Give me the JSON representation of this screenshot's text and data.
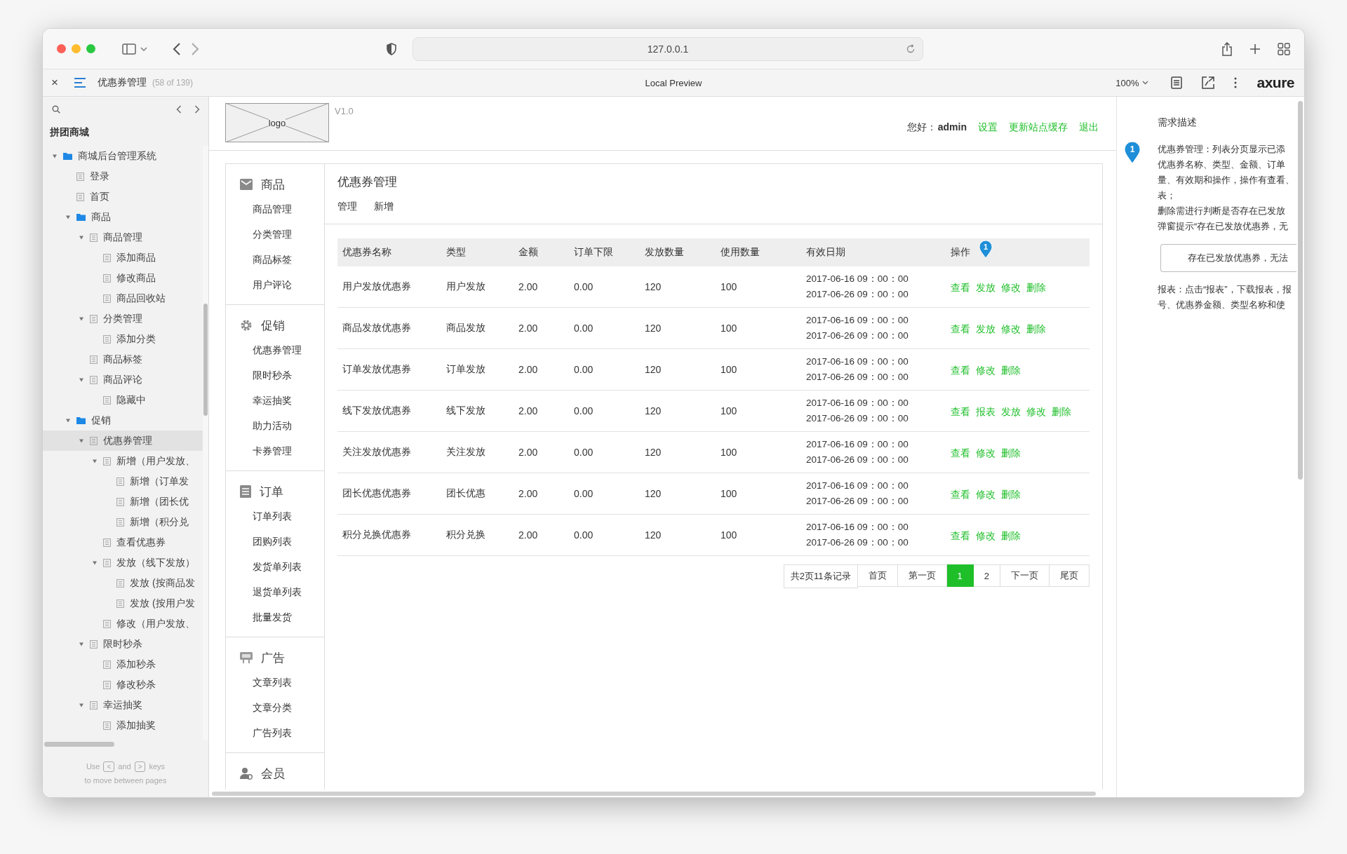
{
  "browser": {
    "url": "127.0.0.1"
  },
  "axure_bar": {
    "close": "×",
    "page_title": "优惠券管理",
    "page_count": "(58 of 139)",
    "center": "Local Preview",
    "zoom": "100%",
    "logo": "axure"
  },
  "sidebar": {
    "project": "拼团商城",
    "tree": [
      {
        "kind": "folder",
        "label": "商城后台管理系统",
        "expanded": true,
        "selected": false,
        "children": [
          {
            "kind": "page",
            "label": "登录",
            "selected": false
          },
          {
            "kind": "page",
            "label": "首页",
            "selected": false
          },
          {
            "kind": "folder",
            "label": "商品",
            "expanded": true,
            "selected": false,
            "children": [
              {
                "kind": "page",
                "label": "商品管理",
                "expanded": true,
                "selected": false,
                "children": [
                  {
                    "kind": "page",
                    "label": "添加商品",
                    "selected": false
                  },
                  {
                    "kind": "page",
                    "label": "修改商品",
                    "selected": false
                  },
                  {
                    "kind": "page",
                    "label": "商品回收站",
                    "selected": false
                  }
                ]
              },
              {
                "kind": "page",
                "label": "分类管理",
                "expanded": true,
                "selected": false,
                "children": [
                  {
                    "kind": "page",
                    "label": "添加分类",
                    "selected": false
                  }
                ]
              },
              {
                "kind": "page",
                "label": "商品标签",
                "selected": false
              },
              {
                "kind": "page",
                "label": "商品评论",
                "expanded": true,
                "selected": false,
                "children": [
                  {
                    "kind": "page",
                    "label": "隐藏中",
                    "selected": false
                  }
                ]
              }
            ]
          },
          {
            "kind": "folder",
            "label": "促销",
            "expanded": true,
            "selected": false,
            "children": [
              {
                "kind": "page",
                "label": "优惠券管理",
                "expanded": true,
                "selected": true,
                "children": [
                  {
                    "kind": "page",
                    "label": "新增（用户发放、",
                    "expanded": true,
                    "selected": false,
                    "children": [
                      {
                        "kind": "page",
                        "label": "新增（订单发",
                        "selected": false
                      },
                      {
                        "kind": "page",
                        "label": "新增（团长优",
                        "selected": false
                      },
                      {
                        "kind": "page",
                        "label": "新增（积分兑",
                        "selected": false
                      }
                    ]
                  },
                  {
                    "kind": "page",
                    "label": "查看优惠券",
                    "selected": false
                  },
                  {
                    "kind": "page",
                    "label": "发放（线下发放）",
                    "expanded": true,
                    "selected": false,
                    "children": [
                      {
                        "kind": "page",
                        "label": "发放 (按商品发",
                        "selected": false
                      },
                      {
                        "kind": "page",
                        "label": "发放 (按用户发",
                        "selected": false
                      }
                    ]
                  },
                  {
                    "kind": "page",
                    "label": "修改（用户发放、",
                    "selected": false
                  }
                ]
              },
              {
                "kind": "page",
                "label": "限时秒杀",
                "expanded": true,
                "selected": false,
                "children": [
                  {
                    "kind": "page",
                    "label": "添加秒杀",
                    "selected": false
                  },
                  {
                    "kind": "page",
                    "label": "修改秒杀",
                    "selected": false
                  }
                ]
              },
              {
                "kind": "page",
                "label": "幸运抽奖",
                "expanded": true,
                "selected": false,
                "children": [
                  {
                    "kind": "page",
                    "label": "添加抽奖",
                    "selected": false
                  }
                ]
              }
            ]
          }
        ]
      }
    ],
    "footer": {
      "use": "Use",
      "key_prev": "<",
      "and": "and",
      "key_next": ">",
      "keys": "keys",
      "hint": "to move between pages"
    }
  },
  "header": {
    "logo": "logo",
    "version": "V1.0",
    "greeting": "您好：",
    "user": "admin",
    "links": [
      "设置",
      "更新站点缓存",
      "退出"
    ]
  },
  "nav": [
    {
      "title": "商品",
      "items": [
        "商品管理",
        "分类管理",
        "商品标签",
        "用户评论"
      ]
    },
    {
      "title": "促销",
      "items": [
        "优惠券管理",
        "限时秒杀",
        "幸运抽奖",
        "助力活动",
        "卡券管理"
      ]
    },
    {
      "title": "订单",
      "items": [
        "订单列表",
        "团购列表",
        "发货单列表",
        "退货单列表",
        "批量发货"
      ]
    },
    {
      "title": "广告",
      "items": [
        "文章列表",
        "文章分类",
        "广告列表"
      ]
    },
    {
      "title": "会员"
    }
  ],
  "content": {
    "title": "优惠券管理",
    "tabs": [
      "管理",
      "新增"
    ],
    "table": {
      "columns": [
        "优惠券名称",
        "类型",
        "金额",
        "订单下限",
        "发放数量",
        "使用数量",
        "有效日期",
        "操作"
      ],
      "marker": "1",
      "rows": [
        {
          "name": "用户发放优惠券",
          "type": "用户发放",
          "amount": "2.00",
          "min_order": "0.00",
          "issued": "120",
          "used": "100",
          "date_start": "2017-06-16 09：00：00",
          "date_end": "2017-06-26 09：00：00",
          "actions": [
            "查看",
            "发放",
            "修改",
            "删除"
          ]
        },
        {
          "name": "商品发放优惠券",
          "type": "商品发放",
          "amount": "2.00",
          "min_order": "0.00",
          "issued": "120",
          "used": "100",
          "date_start": "2017-06-16 09：00：00",
          "date_end": "2017-06-26 09：00：00",
          "actions": [
            "查看",
            "发放",
            "修改",
            "删除"
          ]
        },
        {
          "name": "订单发放优惠券",
          "type": "订单发放",
          "amount": "2.00",
          "min_order": "0.00",
          "issued": "120",
          "used": "100",
          "date_start": "2017-06-16 09：00：00",
          "date_end": "2017-06-26 09：00：00",
          "actions": [
            "查看",
            "修改",
            "删除"
          ]
        },
        {
          "name": "线下发放优惠券",
          "type": "线下发放",
          "amount": "2.00",
          "min_order": "0.00",
          "issued": "120",
          "used": "100",
          "date_start": "2017-06-16 09：00：00",
          "date_end": "2017-06-26 09：00：00",
          "actions": [
            "查看",
            "报表",
            "发放",
            "修改",
            "删除"
          ]
        },
        {
          "name": "关注发放优惠券",
          "type": "关注发放",
          "amount": "2.00",
          "min_order": "0.00",
          "issued": "120",
          "used": "100",
          "date_start": "2017-06-16 09：00：00",
          "date_end": "2017-06-26 09：00：00",
          "actions": [
            "查看",
            "修改",
            "删除"
          ]
        },
        {
          "name": "团长优惠优惠券",
          "type": "团长优惠",
          "amount": "2.00",
          "min_order": "0.00",
          "issued": "120",
          "used": "100",
          "date_start": "2017-06-16 09：00：00",
          "date_end": "2017-06-26 09：00：00",
          "actions": [
            "查看",
            "修改",
            "删除"
          ]
        },
        {
          "name": "积分兑换优惠券",
          "type": "积分兑换",
          "amount": "2.00",
          "min_order": "0.00",
          "issued": "120",
          "used": "100",
          "date_start": "2017-06-16 09：00：00",
          "date_end": "2017-06-26 09：00：00",
          "actions": [
            "查看",
            "修改",
            "删除"
          ]
        }
      ]
    },
    "pagination": {
      "summary": "共2页11条记录",
      "buttons": [
        {
          "label": "首页",
          "selected": false
        },
        {
          "label": "第一页",
          "selected": false
        },
        {
          "label": "1",
          "selected": true
        },
        {
          "label": "2",
          "selected": false
        },
        {
          "label": "下一页",
          "selected": false
        },
        {
          "label": "尾页",
          "selected": false
        }
      ]
    }
  },
  "notes": {
    "title": "需求描述",
    "marker": "1",
    "lines": [
      "优惠券管理：列表分页显示已添",
      "优惠券名称、类型、金额、订单",
      "量、有效期和操作，操作有查看、",
      "表；",
      "删除需进行判断是否存在已发放",
      "弹窗提示“存在已发放优惠券，无"
    ],
    "alert": "存在已发放优惠券，无法",
    "lines_after": [
      "报表：点击“报表”，下载报表，报",
      "号、优惠券金额、类型名称和使"
    ]
  }
}
